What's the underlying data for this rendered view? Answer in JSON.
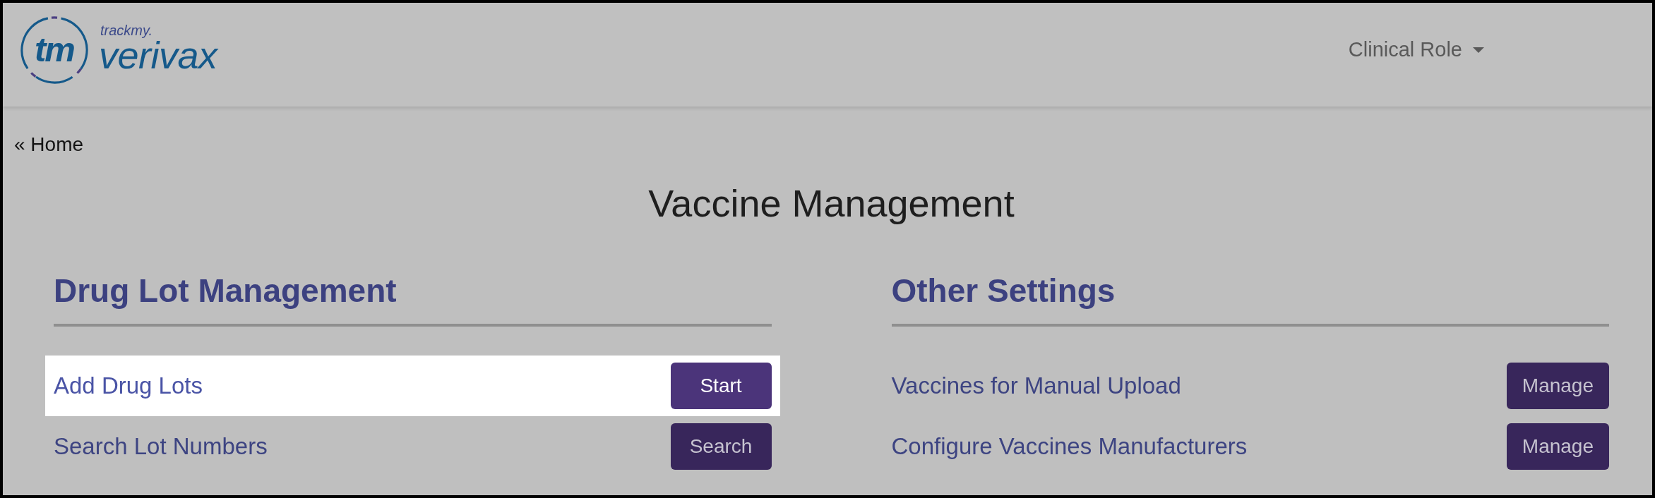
{
  "navbar": {
    "logo": {
      "monogram": "tm",
      "tagline": "trackmy.",
      "wordmark": "verivax"
    },
    "role_menu": {
      "label": "Clinical Role"
    }
  },
  "back_link": {
    "label": "« Home"
  },
  "page_title": "Vaccine Management",
  "sections": [
    {
      "title": "Drug Lot Management",
      "rows": [
        {
          "label": "Add Drug Lots",
          "button": "Start",
          "highlighted": true
        },
        {
          "label": "Search Lot Numbers",
          "button": "Search",
          "highlighted": false
        }
      ]
    },
    {
      "title": "Other Settings",
      "rows": [
        {
          "label": "Vaccines for Manual Upload",
          "button": "Manage",
          "highlighted": false
        },
        {
          "label": "Configure Vaccines Manufacturers",
          "button": "Manage",
          "highlighted": false
        }
      ]
    }
  ]
}
